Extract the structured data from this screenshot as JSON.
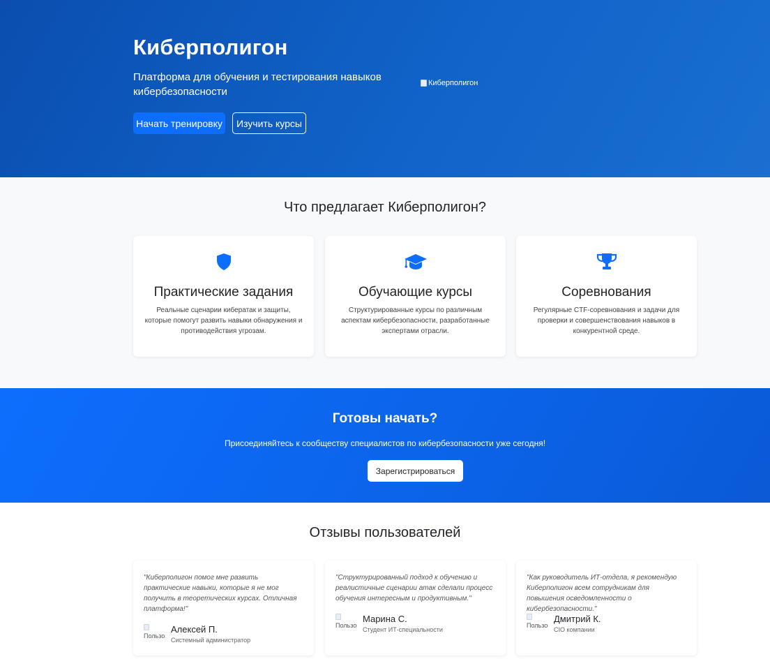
{
  "hero": {
    "title": "Киберполигон",
    "subtitle": "Платформа для обучения и тестирования навыков кибербезопасности",
    "primary_button": "Начать тренировку",
    "secondary_button": "Изучить курсы",
    "image_alt": "Киберполигон"
  },
  "features": {
    "title": "Что предлагает Киберполигон?",
    "items": [
      {
        "icon": "shield-icon",
        "title": "Практические задания",
        "text": "Реальные сценарии кибератак и защиты, которые помогут развить навыки обнаружения и противодействия угрозам."
      },
      {
        "icon": "graduation-cap-icon",
        "title": "Обучающие курсы",
        "text": "Структурированные курсы по различным аспектам кибербезопасности, разработанные экспертами отрасли."
      },
      {
        "icon": "trophy-icon",
        "title": "Соревнования",
        "text": "Регулярные CTF-соревнования и задачи для проверки и совершенствования навыков в конкурентной среде."
      }
    ]
  },
  "cta": {
    "title": "Готовы начать?",
    "text": "Присоединяйтесь к сообществу специалистов по кибербезопасности уже сегодня!",
    "button": "Зарегистрироваться"
  },
  "reviews": {
    "title": "Отзывы пользователей",
    "items": [
      {
        "quote": "\"Киберполигон помог мне развить практические навыки, которые я не мог получить в теоретических курсах. Отличная платформа!\"",
        "avatar_alt": "Пользователь",
        "name": "Алексей П.",
        "role": "Системный администратор"
      },
      {
        "quote": "\"Структурированный подход к обучению и реалистичные сценарии атак сделали процесс обучения интересным и продуктивным.\"",
        "avatar_alt": "Пользователь",
        "name": "Марина С.",
        "role": "Студент ИТ-специальности"
      },
      {
        "quote": "\"Как руководитель ИТ-отдела, я рекомендую Киберполигон всем сотрудникам для повышения осведомленности о кибербезопасности.\"",
        "avatar_alt": "Пользователь",
        "name": "Дмитрий К.",
        "role": "CIO компании"
      }
    ]
  },
  "colors": {
    "primary": "#0d6efd",
    "hero_bg": "#0b4eaf",
    "light_bg": "#f8f9fa"
  }
}
